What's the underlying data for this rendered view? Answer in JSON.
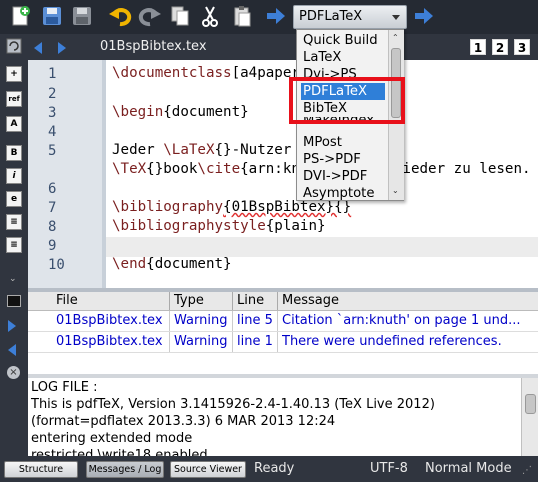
{
  "toolbar": {
    "icons": [
      "new-file-icon",
      "save-icon",
      "save-all-icon",
      "undo-icon",
      "redo-icon",
      "copy-icon",
      "cut-icon",
      "paste-icon",
      "compile-run-icon",
      "view-output-icon"
    ],
    "compiler": "PDFLaTeX"
  },
  "tabbar": {
    "filename": "01BspBibtex.tex",
    "views": [
      "1",
      "2",
      "3"
    ]
  },
  "sidebar": {
    "icons": [
      "structure-icon",
      "ref",
      "bibitem",
      "bold",
      "italic",
      "emph",
      "list-icon",
      "list2-icon",
      "more-icon",
      "messages-icon",
      "next-icon",
      "prev-icon",
      "close-icon"
    ]
  },
  "editor": {
    "line_numbers": [
      "1",
      "2",
      "3",
      "4",
      "5",
      "6",
      "7",
      "8",
      "9",
      "10"
    ],
    "lines": {
      "l1_cmd": "\\documentclass",
      "l1_rest": "[a4paper]{scrartcl}",
      "l3_cmd": "\\begin",
      "l3_rest": "{document}",
      "l5_a": "Jeder ",
      "l5_cmd": "\\LaTeX",
      "l5_rest": "{}-Nutzer liebt das",
      "l6_cmd": "\\TeX",
      "l6_mid": "{}book",
      "l6_cmd2": "\\cite",
      "l6_rest": "{arn:knuth} immer wieder zu lesen.",
      "l7_cmd": "\\bibliography",
      "l7_rest": "{01BspBibtex}{}",
      "l8_cmd": "\\bibliographystyle",
      "l8_rest": "{plain}",
      "l10_cmd": "\\end",
      "l10_rest": "{document}"
    }
  },
  "messages": {
    "headers": [
      "File",
      "Type",
      "Line",
      "Message"
    ],
    "rows": [
      {
        "file": "01BspBibtex.tex",
        "type": "Warning",
        "line": "line 5",
        "message": "Citation `arn:knuth' on page 1 und..."
      },
      {
        "file": "01BspBibtex.tex",
        "type": "Warning",
        "line": "line 1",
        "message": "There were undefined references."
      }
    ]
  },
  "log": {
    "lines": [
      "LOG FILE :",
      "This is pdfTeX, Version 3.1415926-2.4-1.40.13 (TeX Live 2012)",
      "(format=pdflatex 2013.3.3) 6 MAR 2013 12:24",
      "entering extended mode",
      "restricted \\write18 enabled."
    ]
  },
  "statusbar": {
    "buttons": [
      "Structure",
      "Messages / Log",
      "Source Viewer"
    ],
    "status": "Ready",
    "encoding": "UTF-8",
    "mode": "Normal Mode"
  },
  "dropdown": {
    "options": [
      "Quick Build",
      "LaTeX",
      "Dvi->PS",
      "PDFLaTeX",
      "BibTeX",
      "MakeIndex",
      "MPost",
      "PS->PDF",
      "DVI->PDF",
      "Asymptote"
    ],
    "selected": "PDFLaTeX"
  },
  "colors": {
    "highlight": "#e8101a",
    "selection": "#2f7fd8",
    "keyword": "#7a1f1f",
    "message_text": "#0000c8"
  }
}
